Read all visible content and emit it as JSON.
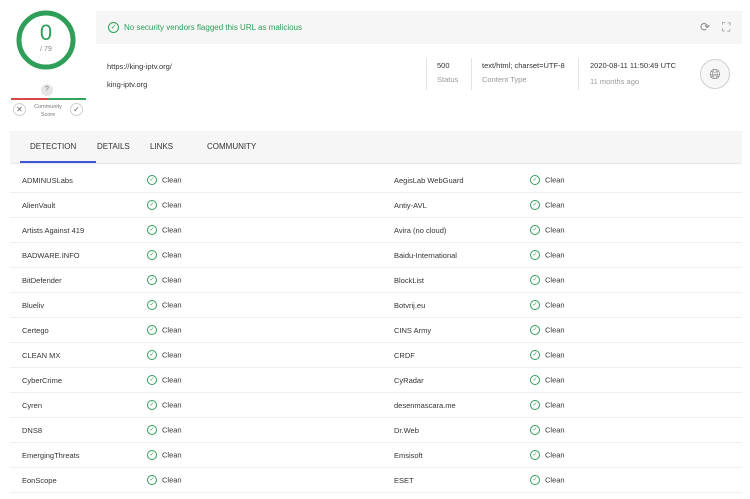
{
  "score": {
    "detected": "0",
    "total": "/ 79"
  },
  "community": {
    "score": "?",
    "label_line1": "Community",
    "label_line2": "Score"
  },
  "banner": {
    "message": "No security vendors flagged this URL as malicious"
  },
  "url_info": {
    "url": "https://king-iptv.org/",
    "host": "king-iptv.org",
    "status_value": "500",
    "status_label": "Status",
    "content_type_value": "text/html; charset=UTF-8",
    "content_type_label": "Content Type",
    "date_value": "2020-08-11 11:50:49 UTC",
    "date_relative": "11 months ago"
  },
  "tabs": [
    {
      "label": "DETECTION",
      "active": true
    },
    {
      "label": "DETAILS",
      "active": false
    },
    {
      "label": "LINKS",
      "active": false
    },
    {
      "label": "COMMUNITY",
      "active": false
    }
  ],
  "rows": [
    {
      "left": {
        "vendor": "ADMINUSLabs",
        "result": "Clean"
      },
      "right": {
        "vendor": "AegisLab WebGuard",
        "result": "Clean"
      }
    },
    {
      "left": {
        "vendor": "AlienVault",
        "result": "Clean"
      },
      "right": {
        "vendor": "Antiy-AVL",
        "result": "Clean"
      }
    },
    {
      "left": {
        "vendor": "Artists Against 419",
        "result": "Clean"
      },
      "right": {
        "vendor": "Avira (no cloud)",
        "result": "Clean"
      }
    },
    {
      "left": {
        "vendor": "BADWARE.INFO",
        "result": "Clean"
      },
      "right": {
        "vendor": "Baidu-International",
        "result": "Clean"
      }
    },
    {
      "left": {
        "vendor": "BitDefender",
        "result": "Clean"
      },
      "right": {
        "vendor": "BlockList",
        "result": "Clean"
      }
    },
    {
      "left": {
        "vendor": "Blueliv",
        "result": "Clean"
      },
      "right": {
        "vendor": "Botvrij.eu",
        "result": "Clean"
      }
    },
    {
      "left": {
        "vendor": "Certego",
        "result": "Clean"
      },
      "right": {
        "vendor": "CINS Army",
        "result": "Clean"
      }
    },
    {
      "left": {
        "vendor": "CLEAN MX",
        "result": "Clean"
      },
      "right": {
        "vendor": "CRDF",
        "result": "Clean"
      }
    },
    {
      "left": {
        "vendor": "CyberCrime",
        "result": "Clean"
      },
      "right": {
        "vendor": "CyRadar",
        "result": "Clean"
      }
    },
    {
      "left": {
        "vendor": "Cyren",
        "result": "Clean"
      },
      "right": {
        "vendor": "desenmascara.me",
        "result": "Clean"
      }
    },
    {
      "left": {
        "vendor": "DNS8",
        "result": "Clean"
      },
      "right": {
        "vendor": "Dr.Web",
        "result": "Clean"
      }
    },
    {
      "left": {
        "vendor": "EmergingThreats",
        "result": "Clean"
      },
      "right": {
        "vendor": "Emsisoft",
        "result": "Clean"
      }
    },
    {
      "left": {
        "vendor": "EonScope",
        "result": "Clean"
      },
      "right": {
        "vendor": "ESET",
        "result": "Clean"
      }
    }
  ],
  "colors": {
    "clean": "#2e9e58",
    "tab_underline": "#3b57d6",
    "malicious": "#d94848"
  },
  "icons": {
    "result": "check-circle-icon",
    "refresh": "refresh-icon",
    "graph": "graph-icon",
    "globe": "globe-icon"
  }
}
